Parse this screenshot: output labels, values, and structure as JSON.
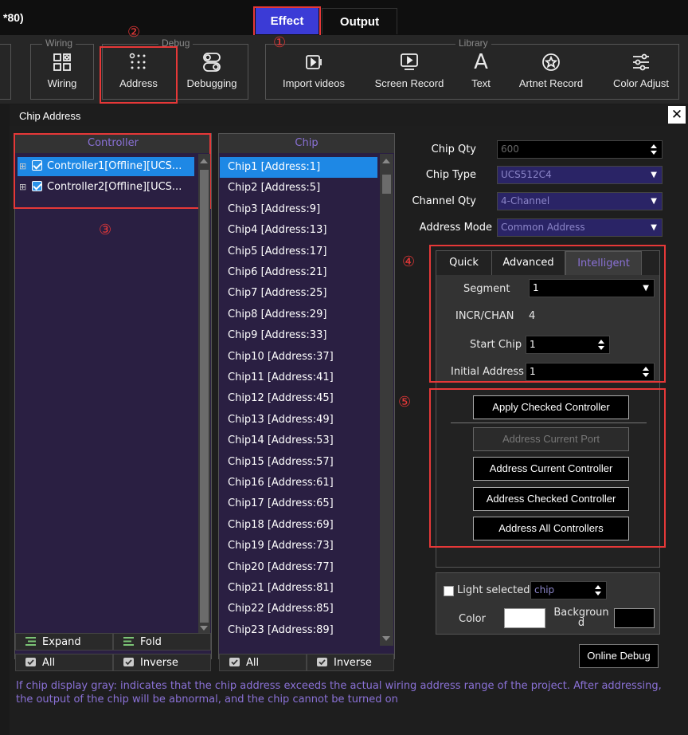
{
  "window": {
    "title_fragment": "*80)"
  },
  "top_tabs": {
    "effect": "Effect",
    "output": "Output"
  },
  "toolbar": {
    "groups": {
      "wiring": "Wiring",
      "debug": "Debug",
      "library": "Library"
    },
    "tools": {
      "wiring": "Wiring",
      "address": "Address",
      "debugging": "Debugging",
      "import_videos": "Import videos",
      "screen_record": "Screen Record",
      "text": "Text",
      "artnet_record": "Artnet Record",
      "color_adjust": "Color Adjust"
    },
    "text_glyph": "A"
  },
  "annotations": {
    "n1": "①",
    "n2": "②",
    "n3": "③",
    "n4": "④",
    "n5": "⑤"
  },
  "dialog": {
    "title": "Chip Address",
    "close_glyph": "✕",
    "controller_panel": {
      "header": "Controller",
      "items": [
        {
          "label": "Controller1[Offline][UCS...",
          "checked": true,
          "selected": true
        },
        {
          "label": "Controller2[Offline][UCS...",
          "checked": true,
          "selected": false
        }
      ],
      "expand_label": "Expand",
      "fold_label": "Fold",
      "all_label": "All",
      "inverse_label": "Inverse"
    },
    "chip_panel": {
      "header": "Chip",
      "chips": [
        "Chip1 [Address:1]",
        "Chip2 [Address:5]",
        "Chip3 [Address:9]",
        "Chip4 [Address:13]",
        "Chip5 [Address:17]",
        "Chip6 [Address:21]",
        "Chip7 [Address:25]",
        "Chip8 [Address:29]",
        "Chip9 [Address:33]",
        "Chip10 [Address:37]",
        "Chip11 [Address:41]",
        "Chip12 [Address:45]",
        "Chip13 [Address:49]",
        "Chip14 [Address:53]",
        "Chip15 [Address:57]",
        "Chip16 [Address:61]",
        "Chip17 [Address:65]",
        "Chip18 [Address:69]",
        "Chip19 [Address:73]",
        "Chip20 [Address:77]",
        "Chip21 [Address:81]",
        "Chip22 [Address:85]",
        "Chip23 [Address:89]"
      ],
      "all_label": "All",
      "inverse_label": "Inverse"
    },
    "settings": {
      "chip_qty_label": "Chip Qty",
      "chip_qty_value": "600",
      "chip_type_label": "Chip Type",
      "chip_type_value": "UCS512C4",
      "channel_qty_label": "Channel Qty",
      "channel_qty_value": "4-Channel",
      "address_mode_label": "Address Mode",
      "address_mode_value": "Common Address"
    },
    "mode_tabs": {
      "quick": "Quick",
      "advanced": "Advanced",
      "intelligent": "Intelligent"
    },
    "intelligent": {
      "segment_label": "Segment",
      "segment_value": "1",
      "incr_label": "INCR/CHAN",
      "incr_value": "4",
      "start_chip_label": "Start Chip",
      "start_chip_value": "1",
      "initial_address_label": "Initial Address",
      "initial_address_value": "1"
    },
    "actions": {
      "apply_checked": "Apply Checked Controller",
      "address_current_port": "Address Current Port",
      "address_current_controller": "Address Current Controller",
      "address_checked_controller": "Address Checked Controller",
      "address_all_controllers": "Address All Controllers"
    },
    "light": {
      "light_selected_label": "Light selected",
      "light_selected_value": "chip",
      "color_label": "Color",
      "background_label": "Backgroun\nd",
      "color_value": "#ffffff",
      "background_value": "#000000"
    },
    "online_debug": "Online Debug",
    "note": "If chip display gray: indicates that the chip address exceeds the actual wiring address range of the project. After addressing, the output of the chip will be abnormal, and the chip cannot be turned on"
  },
  "colors": {
    "accent": "#3b3bd6",
    "highlight": "#e63838",
    "selection": "#1e88e5",
    "purple_text": "#8a71d6"
  }
}
